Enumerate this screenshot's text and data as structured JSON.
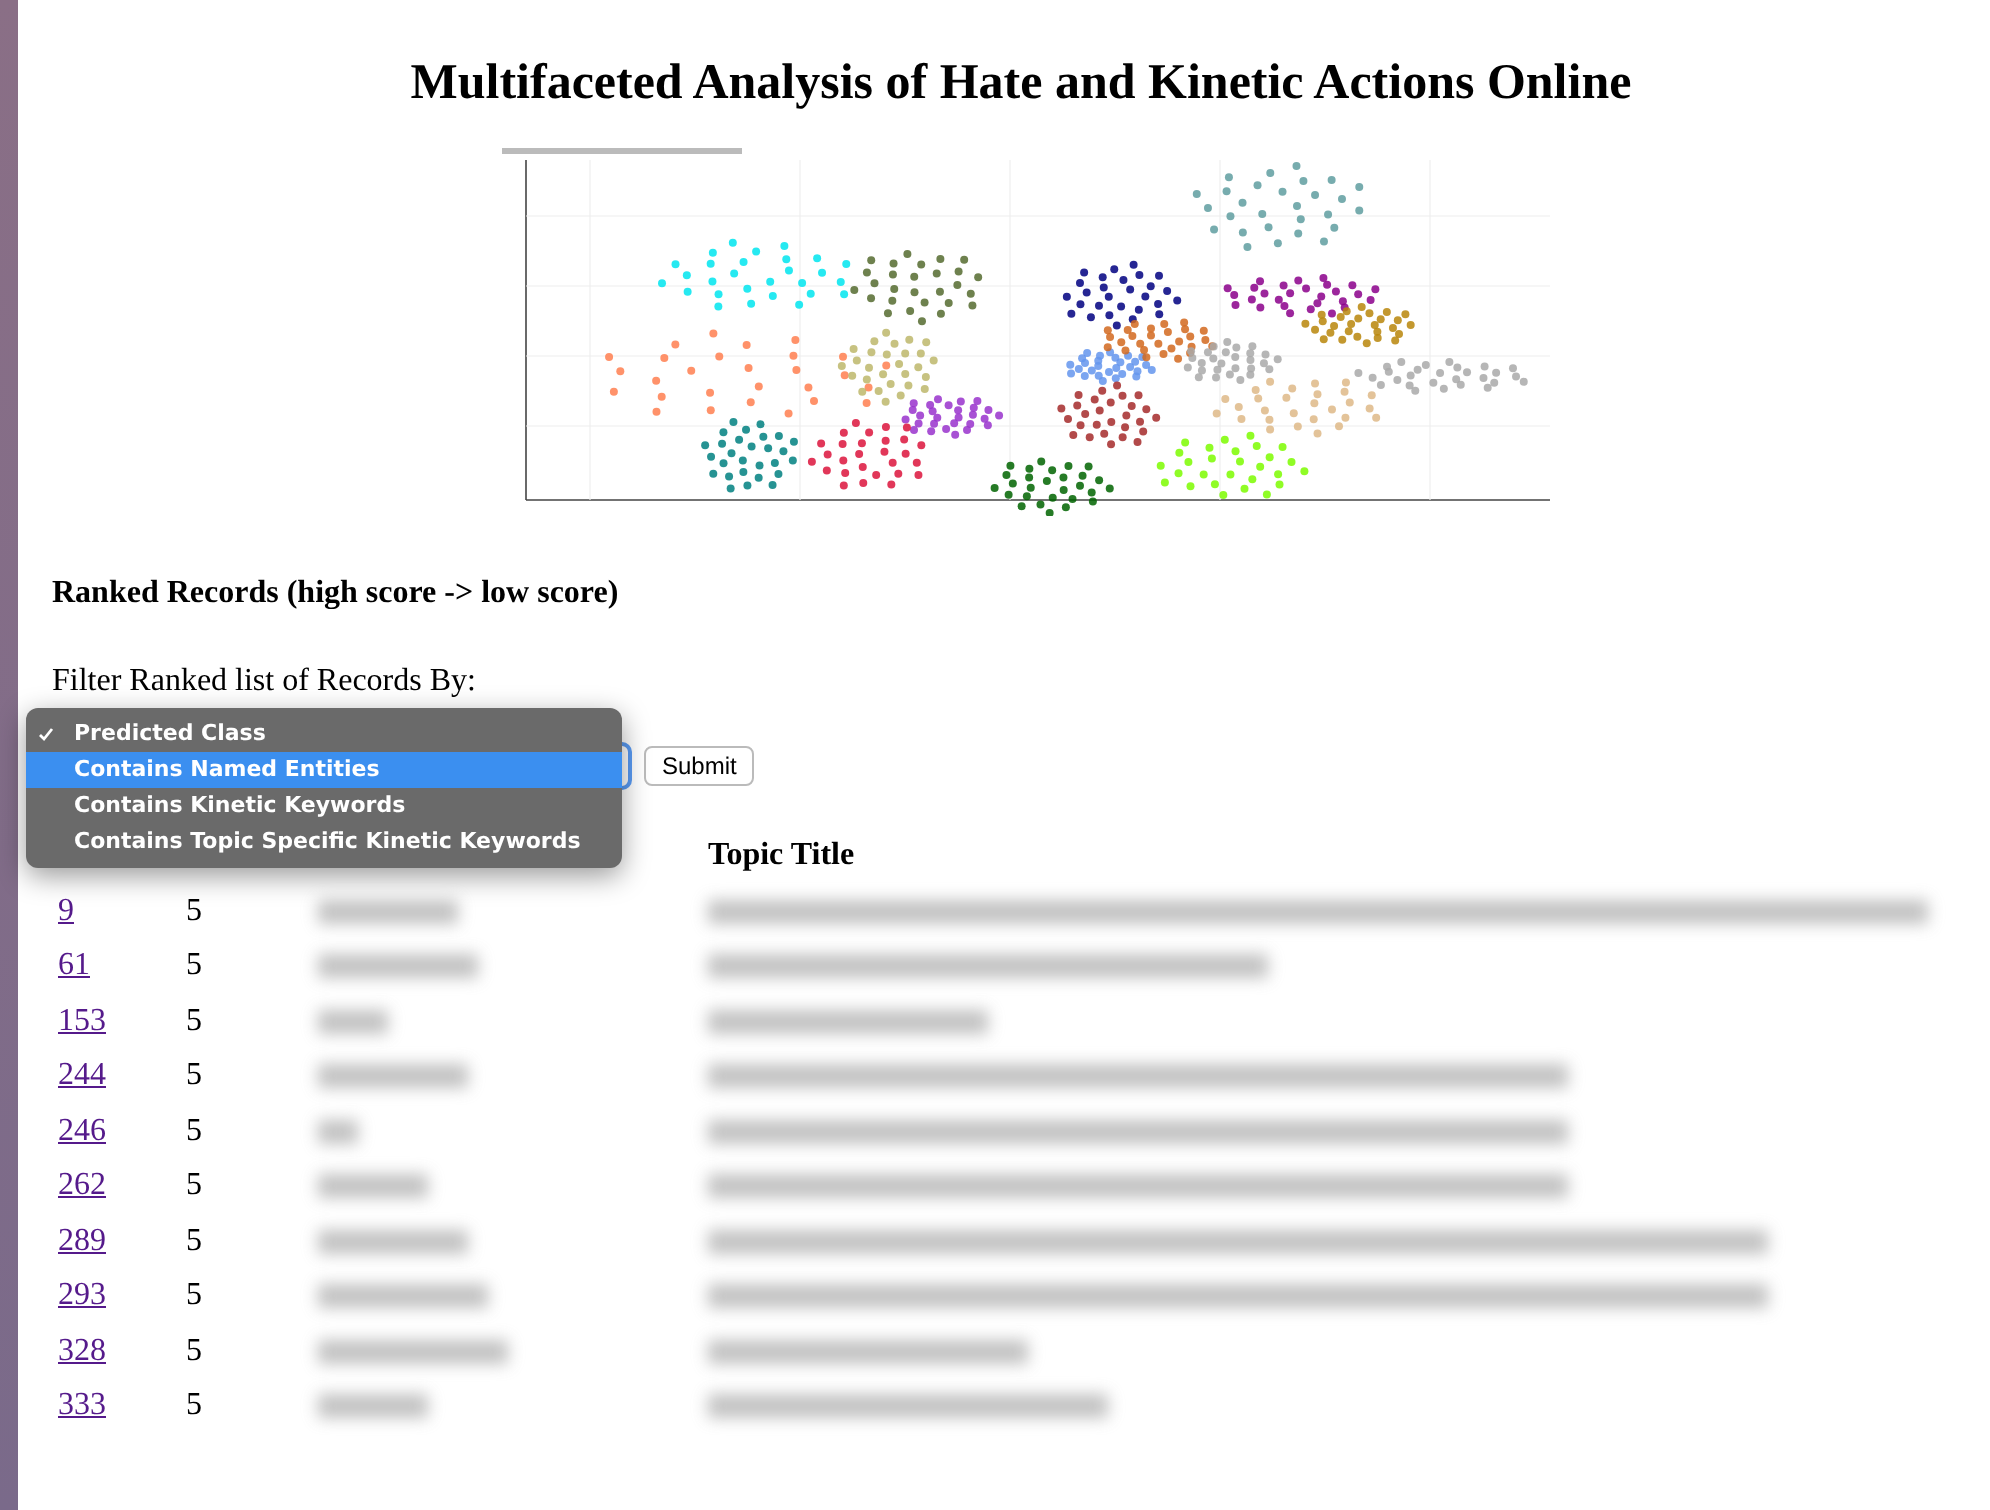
{
  "title": "Multifaceted Analysis of Hate and Kinetic Actions Online",
  "plot": {
    "kind": "cluster-scatter"
  },
  "section_heading": "Ranked Records (high score -> low score)",
  "filter_label": "Filter Ranked list of Records By:",
  "filter_menu": {
    "options": [
      {
        "label": "Predicted Class",
        "selected": true,
        "highlighted": false
      },
      {
        "label": "Contains Named Entities",
        "selected": false,
        "highlighted": true
      },
      {
        "label": "Contains Kinetic Keywords",
        "selected": false,
        "highlighted": false
      },
      {
        "label": "Contains Topic Specific Kinetic Keywords",
        "selected": false,
        "highlighted": false
      }
    ]
  },
  "submit_button": "Submit",
  "table": {
    "columns": [
      "Topic Title"
    ],
    "rows": [
      {
        "id": "9",
        "score": "5"
      },
      {
        "id": "61",
        "score": "5"
      },
      {
        "id": "153",
        "score": "5"
      },
      {
        "id": "244",
        "score": "5"
      },
      {
        "id": "246",
        "score": "5"
      },
      {
        "id": "262",
        "score": "5"
      },
      {
        "id": "289",
        "score": "5"
      },
      {
        "id": "293",
        "score": "5"
      },
      {
        "id": "328",
        "score": "5"
      },
      {
        "id": "333",
        "score": "5"
      }
    ]
  }
}
